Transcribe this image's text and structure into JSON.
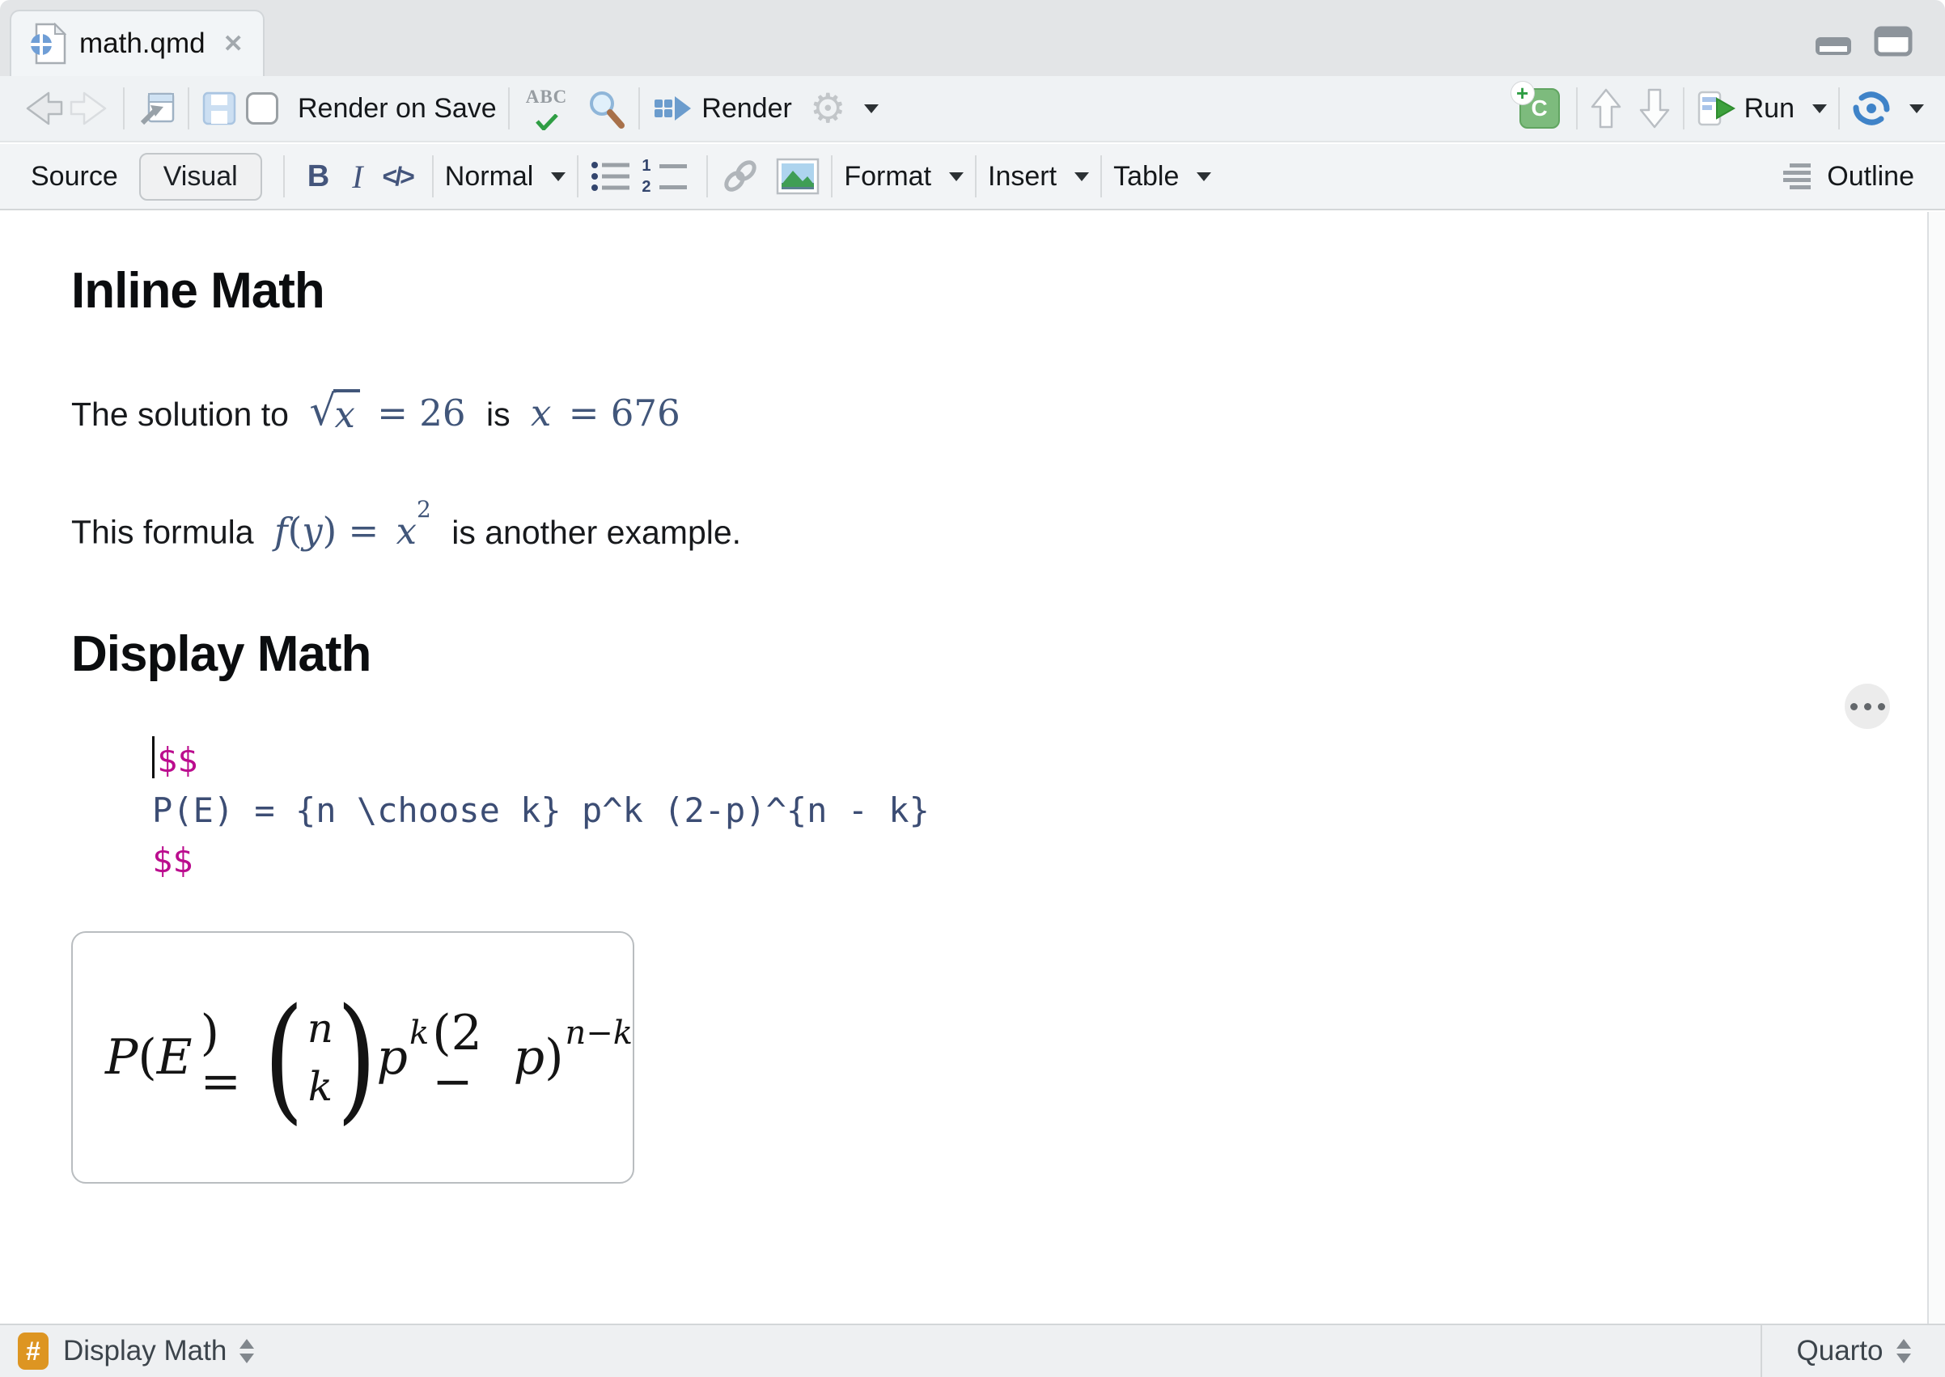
{
  "tab": {
    "title": "math.qmd"
  },
  "toolbar": {
    "render_on_save": "Render on Save",
    "spell_abc": "ABC",
    "render": "Render",
    "run": "Run"
  },
  "format_toolbar": {
    "source": "Source",
    "visual": "Visual",
    "bold": "B",
    "italic": "I",
    "code_inline": "</>",
    "para_style": "Normal",
    "num1": "1",
    "num2": "2",
    "format": "Format",
    "insert": "Insert",
    "table": "Table",
    "outline": "Outline"
  },
  "content": {
    "heading_inline": "Inline Math",
    "heading_display": "Display Math",
    "p1": {
      "pre": "The solution to",
      "sqrt": "√",
      "sqrt_arg": "x",
      "eq": "= 26",
      "mid": "is",
      "x": "x",
      "eq2": "= 676"
    },
    "p2": {
      "pre": "This formula",
      "f": "f",
      "open": "(",
      "y": "y",
      "close": ") =",
      "x": "x",
      "sup": "2",
      "post": "is another example."
    },
    "code": {
      "open": "$$",
      "body": "P(E) = {n \\choose k} p^k (2-p)^{n - k}",
      "close": "$$"
    },
    "formula": {
      "P": "P",
      "open": "(",
      "E": "E",
      "eq": ") =",
      "top": "n",
      "bottom": "k",
      "p": "p",
      "supk": "k",
      "mid": "(2 −",
      "p2": "p",
      "close": ")",
      "supnk": "n−k"
    }
  },
  "status": {
    "badge": "#",
    "section": "Display Math",
    "mode": "Quarto"
  },
  "colors": {
    "math_blue": "#41567a",
    "code_blue": "#3c4d74",
    "math_delim_magenta": "#bb0d8e",
    "heading_badge_orange": "#dd9522",
    "quarto_blue": "#6f9ed6",
    "run_green": "#3da13d",
    "render_blue": "#6b9ccd"
  }
}
